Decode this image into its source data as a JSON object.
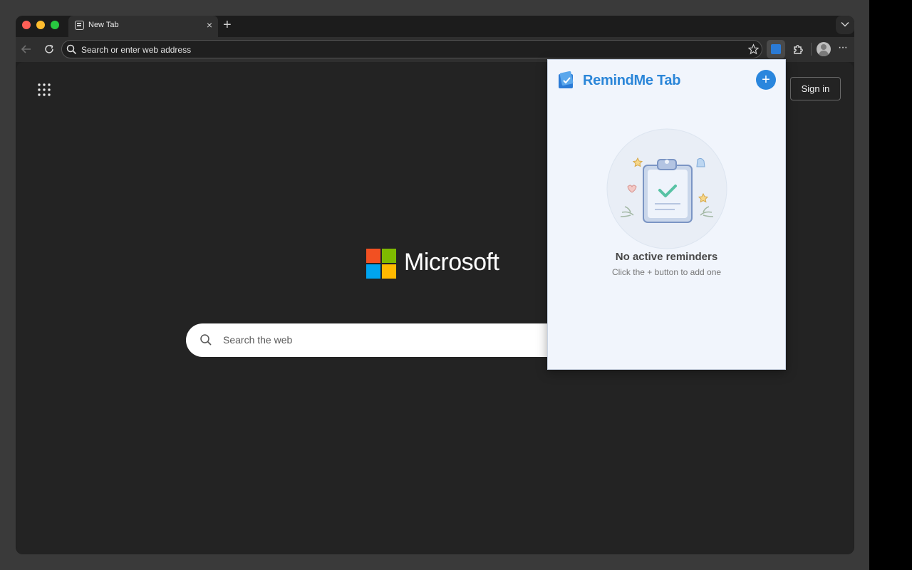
{
  "browser": {
    "tab": {
      "title": "New Tab",
      "close_glyph": "×",
      "icon": "page-icon"
    },
    "new_tab_glyph": "+",
    "address_bar": {
      "placeholder": "Search or enter web address"
    },
    "more_glyph": "···"
  },
  "newtab_page": {
    "sign_in_label": "Sign in",
    "brand": "Microsoft",
    "brand_colors": [
      "#f25022",
      "#7fba00",
      "#00a4ef",
      "#ffb900"
    ],
    "search_placeholder": "Search the web"
  },
  "extension_popup": {
    "title": "RemindMe Tab",
    "title_color": "#2b86d8",
    "add_glyph": "+",
    "empty_title": "No active reminders",
    "empty_subtitle": "Click the + button to add one"
  }
}
